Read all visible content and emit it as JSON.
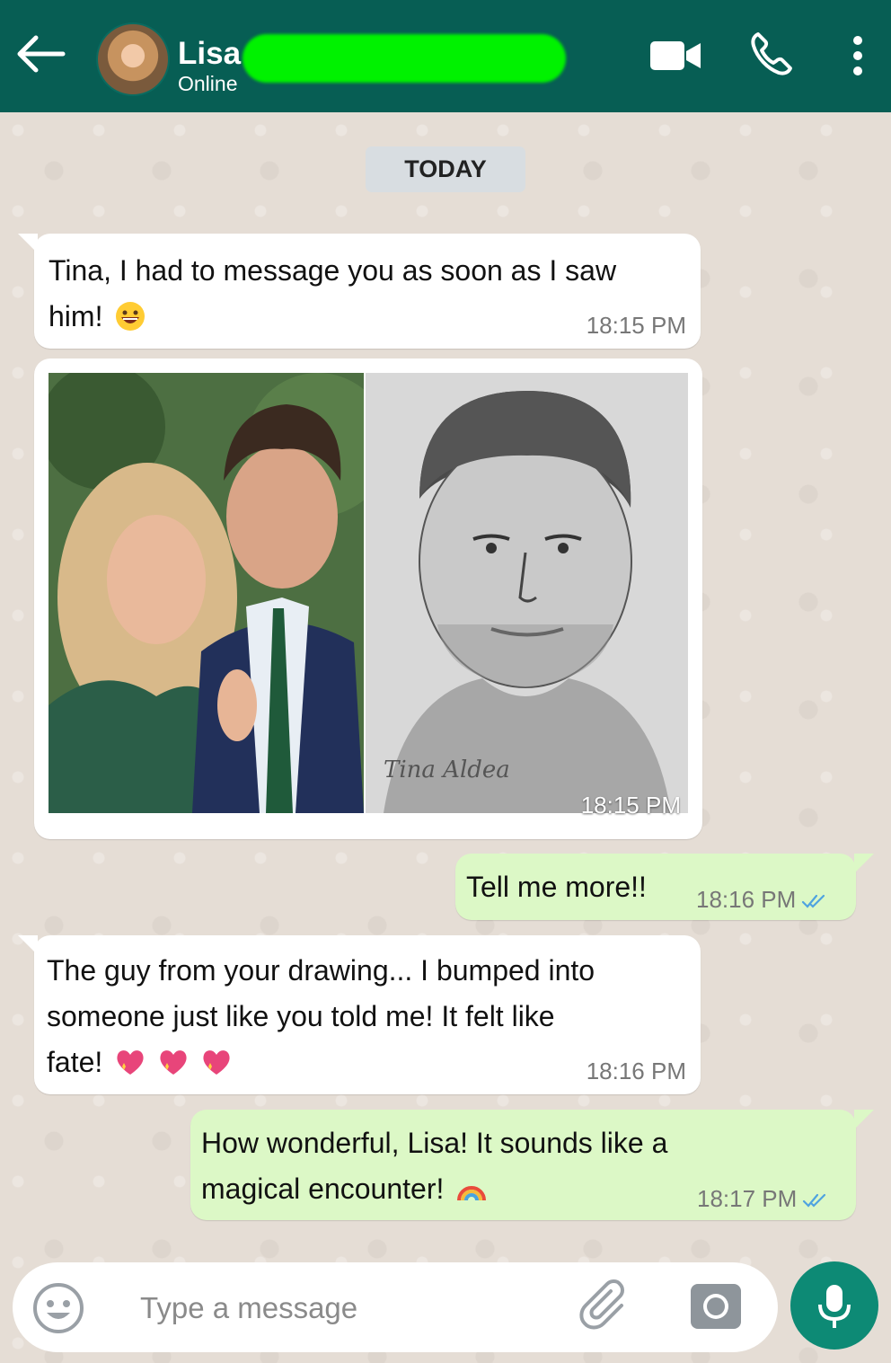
{
  "header": {
    "contact_name": "Lisa",
    "status": "Online",
    "color": "#075e54"
  },
  "chat": {
    "date_label": "TODAY",
    "messages": [
      {
        "direction": "incoming",
        "lines": [
          "Tina, I had to message you as soon as I saw",
          "him!"
        ],
        "emoji": "grinning-face-icon",
        "time": "18:15 PM"
      },
      {
        "direction": "incoming",
        "type": "image",
        "signature": "Tina Aldea",
        "time": "18:15 PM"
      },
      {
        "direction": "outgoing",
        "lines": [
          "Tell me more!!"
        ],
        "time": "18:16 PM",
        "status": "read"
      },
      {
        "direction": "incoming",
        "lines": [
          "The guy from your drawing... I bumped into",
          "someone just like you told me! It felt like",
          "fate!"
        ],
        "emoji": "sparkling-heart-icon",
        "emoji_count": 3,
        "time": "18:16 PM"
      },
      {
        "direction": "outgoing",
        "lines": [
          "How wonderful, Lisa! It sounds like a",
          "magical encounter!"
        ],
        "emoji": "rainbow-icon",
        "time": "18:17 PM",
        "status": "read"
      }
    ]
  },
  "input": {
    "placeholder": "Type a message"
  },
  "colors": {
    "incoming_bubble": "#ffffff",
    "outgoing_bubble": "#dcf8c6",
    "read_ticks": "#4fa3e0",
    "mic_button": "#0d8a75"
  }
}
